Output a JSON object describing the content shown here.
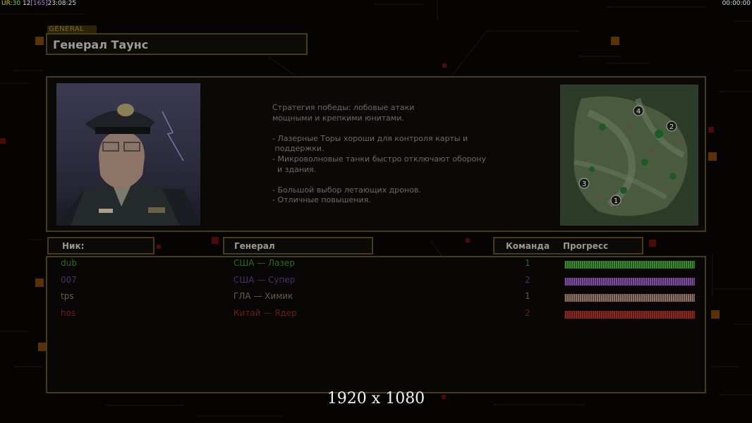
{
  "hud": {
    "ur": "UR:",
    "v1": "30",
    "v2": "12",
    "v3": "[165]",
    "clock": "23:08:25",
    "timer": "00:00:00"
  },
  "general_tag": "GENERAL",
  "general_name": "Генерал Таунс",
  "description": [
    "Стратегия победы: лобовые атаки",
    "мощными и крепкими юнитами.",
    "",
    "- Лазерные Торы хороши для контроля карты и",
    " поддержки.",
    "- Микроволновые танки быстро отключают оборону",
    "  и здания.",
    "",
    "- Большой выбор летающих дронов.",
    "- Отличные повышения."
  ],
  "minimap": {
    "spawns": [
      "1",
      "2",
      "3",
      "4"
    ]
  },
  "table": {
    "headers": {
      "nick": "Ник:",
      "general": "Генерал",
      "team": "Команда",
      "progress": "Прогресс"
    },
    "rows": [
      {
        "nick": "dub",
        "general": "США — Лазер",
        "team": "1",
        "color": "#2c6a1e",
        "bar": "#3a8a30",
        "progress": 1.0
      },
      {
        "nick": "007",
        "general": "США — Супер",
        "team": "2",
        "color": "#4e2a6e",
        "bar": "#7a4aa0",
        "progress": 1.0
      },
      {
        "nick": "tps",
        "general": "ГЛА — Химик",
        "team": "1",
        "color": "#6a5a46",
        "bar": "#8c6e64",
        "progress": 1.0
      },
      {
        "nick": "hos",
        "general": "Китай — Ядер",
        "team": "2",
        "color": "#6e1c16",
        "bar": "#8c2a22",
        "progress": 1.0
      }
    ]
  },
  "resolution_label": "1920 x 1080"
}
